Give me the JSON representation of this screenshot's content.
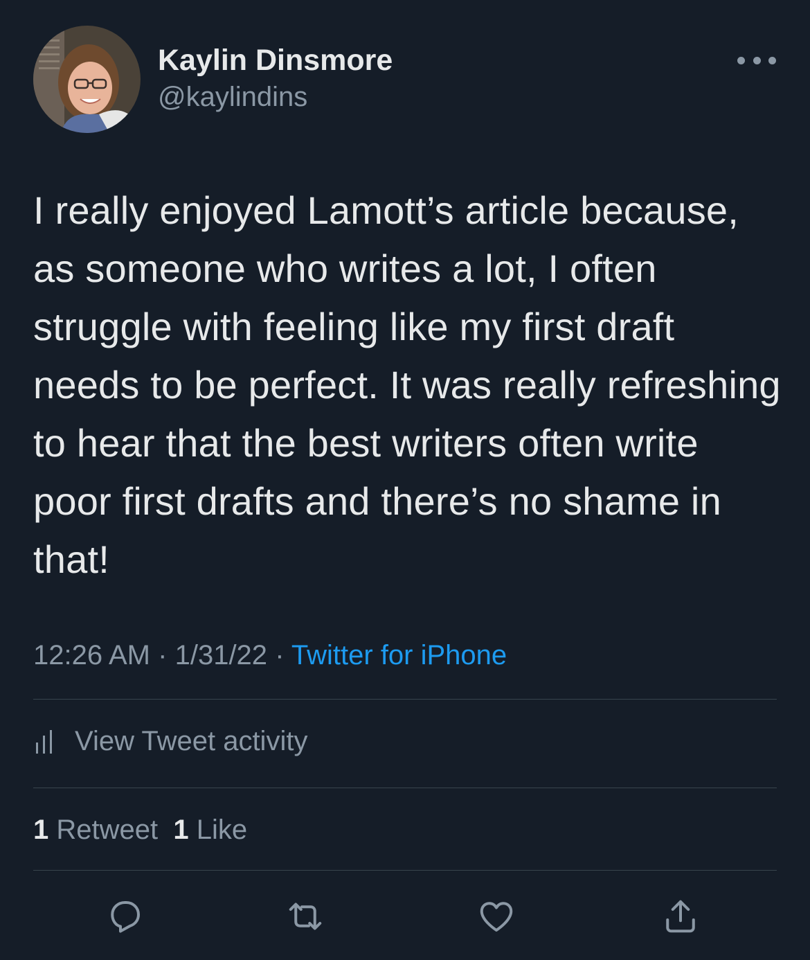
{
  "author": {
    "name": "Kaylin Dinsmore",
    "handle": "@kaylindins",
    "avatar_icon": "profile-photo"
  },
  "tweet": {
    "text": "I really enjoyed Lamott’s article because, as someone who writes a lot, I often struggle with feeling like my first draft needs to be perfect. It was really refreshing to hear that the best writers often write poor first drafts and there’s no shame in that!",
    "time": "12:26 AM",
    "date": "1/31/22",
    "separator": "·",
    "source": "Twitter for iPhone"
  },
  "activity": {
    "label": "View Tweet activity",
    "icon": "bar-chart-icon"
  },
  "stats": {
    "retweets_count": "1",
    "retweets_label": "Retweet",
    "likes_count": "1",
    "likes_label": "Like"
  },
  "actions": {
    "icons": [
      "reply-icon",
      "retweet-icon",
      "like-icon",
      "share-icon"
    ]
  },
  "colors": {
    "background": "#151d28",
    "text": "#e7e9ea",
    "muted": "#8b98a5",
    "link": "#1d9bf0",
    "divider": "#38444d"
  }
}
